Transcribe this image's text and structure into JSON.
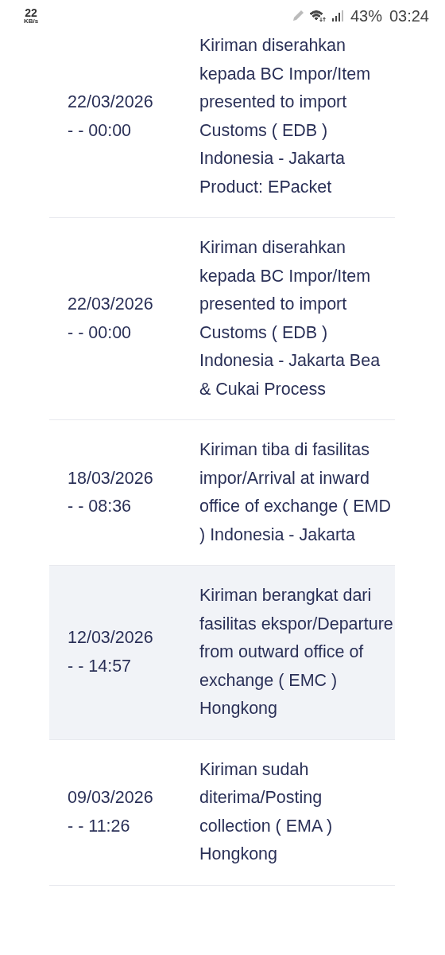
{
  "status_bar": {
    "speed": "22",
    "speed_unit": "KB/s",
    "battery": "43%",
    "time": "03:24"
  },
  "events": [
    {
      "datetime": "22/03/2026 - - 00:00",
      "description": "Kiriman diserahkan kepada BC Impor/Item presented to import Customs ( EDB ) Indonesia - Jakarta Product: EPacket",
      "highlighted": false
    },
    {
      "datetime": "22/03/2026 - - 00:00",
      "description": "Kiriman diserahkan kepada BC Impor/Item presented to import Customs ( EDB ) Indonesia - Jakarta Bea & Cukai Process",
      "highlighted": false
    },
    {
      "datetime": "18/03/2026 - - 08:36",
      "description": "Kiriman tiba di fasilitas impor/Arrival at inward office of exchange ( EMD ) Indonesia - Jakarta",
      "highlighted": false
    },
    {
      "datetime": "12/03/2026 - - 14:57",
      "description": "Kiriman berangkat dari fasilitas ekspor/Departure from outward office of exchange ( EMC ) Hongkong",
      "highlighted": true
    },
    {
      "datetime": "09/03/2026 - - 11:26",
      "description": "Kiriman sudah diterima/Posting collection ( EMA ) Hongkong",
      "highlighted": false
    }
  ]
}
